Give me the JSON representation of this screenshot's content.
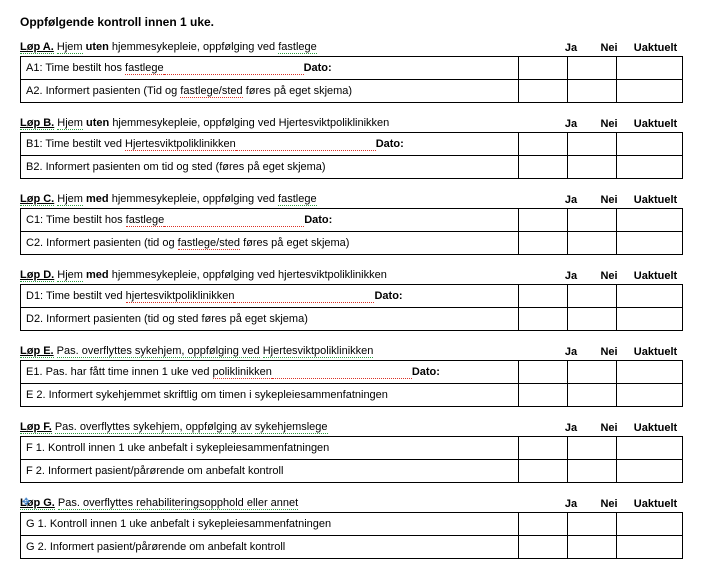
{
  "title": "Oppfølgende kontroll innen 1 uke.",
  "cols": {
    "ja": "Ja",
    "nei": "Nei",
    "ua": "Uaktuelt"
  },
  "sections": [
    {
      "label_prefix": "Løp A.",
      "label_html": "Hjem",
      "label_bold": "uten",
      "label_rest": "hjemmesykepleie, oppfølging ved",
      "label_link": "fastlege",
      "rows": [
        {
          "pre": "A1: Time bestilt hos ",
          "link": "fastlege",
          "dato": "Dato:"
        },
        {
          "pre": "A2. Informert pasienten (Tid og ",
          "link": "fastlege/sted",
          "post": " føres på eget skjema)"
        }
      ]
    },
    {
      "label_prefix": "Løp B.",
      "label_html": "Hjem",
      "label_bold": "uten",
      "label_rest": "hjemmesykepleie, oppfølging ved Hjertesviktpoliklinikken",
      "rows": [
        {
          "pre": "B1: Time bestilt ved ",
          "link": "Hjertesviktpoliklinikken",
          "dato": "Dato:"
        },
        {
          "pre": "B2. Informert pasienten om tid og sted  (føres på eget skjema)"
        }
      ]
    },
    {
      "label_prefix": "Løp C.",
      "label_html": "Hjem",
      "label_bold": "med",
      "label_rest": "hjemmesykepleie, oppfølging ved",
      "label_link": "fastlege",
      "rows": [
        {
          "pre": "C1: Time bestilt hos ",
          "link": "fastlege",
          "dato": "Dato:"
        },
        {
          "pre": "C2. Informert pasienten (tid og ",
          "link": "fastlege/sted",
          "post": " føres på eget skjema)"
        }
      ]
    },
    {
      "label_prefix": "Løp D.",
      "label_html": "Hjem",
      "label_bold": "med",
      "label_rest": "hjemmesykepleie, oppfølging ved hjertesviktpoliklinikken",
      "rows": [
        {
          "pre": "D1: Time bestilt ved ",
          "link": "hjertesviktpoliklinikken",
          "dato": "Dato:"
        },
        {
          "pre": "D2. Informert pasienten (tid og sted føres på eget skjema)"
        }
      ]
    },
    {
      "label_prefix": "Løp E.",
      "label_html": "Pas. overflyttes sykehjem, oppfølging ved",
      "label_link": "Hjertesviktpoliklinikken",
      "rows": [
        {
          "pre": "E1. Pas. har fått time innen 1 uke ved ",
          "link": "poliklinikken",
          "dato": "Dato:"
        },
        {
          "pre": "E 2.  Informert sykehjemmet skriftlig om timen i sykepleiesammenfatningen"
        }
      ]
    },
    {
      "label_prefix": "Løp F.",
      "label_html": "Pas. overflyttes sykehjem, oppfølging av",
      "label_link": "sykehjemslege",
      "rows": [
        {
          "pre": "F 1.  Kontroll innen 1 uke anbefalt i sykepleiesammenfatningen"
        },
        {
          "pre": "F 2.  Informert pasient/pårørende om anbefalt kontroll"
        }
      ]
    },
    {
      "label_prefix": "Løp G.",
      "label_html": "Pas. overflyttes rehabiliteringsopphold eller annet",
      "rows": [
        {
          "pre": "G 1.  Kontroll innen 1 uke anbefalt i sykepleiesammenfatningen"
        },
        {
          "pre": "G 2.  Informert pasient/pårørende om anbefalt kontroll"
        }
      ]
    }
  ]
}
